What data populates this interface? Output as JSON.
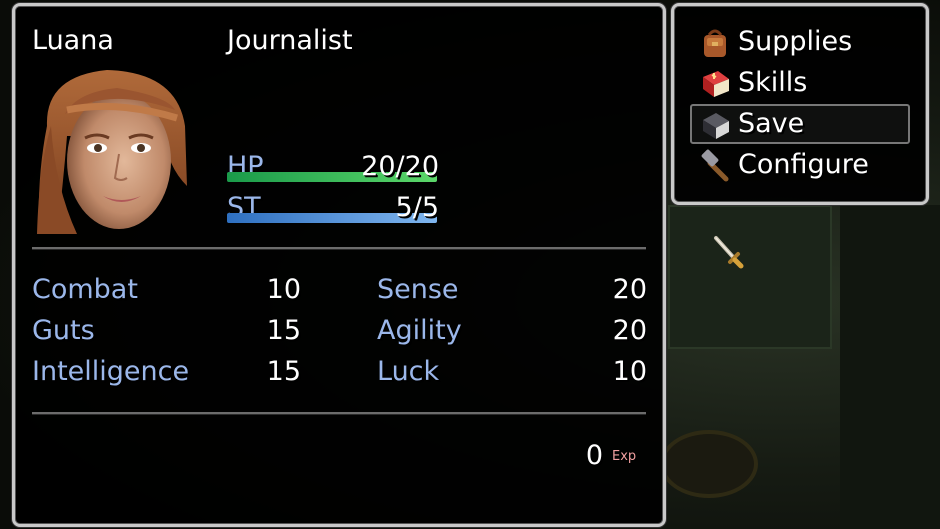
{
  "character": {
    "name": "Luana",
    "class": "Journalist",
    "hp": {
      "label": "HP",
      "value": "20/20",
      "fraction": 1.0
    },
    "st": {
      "label": "ST",
      "value": "5/5",
      "fraction": 1.0
    }
  },
  "stats": {
    "left": [
      {
        "label": "Combat",
        "value": "10"
      },
      {
        "label": "Guts",
        "value": "15"
      },
      {
        "label": "Intelligence",
        "value": "15"
      }
    ],
    "right": [
      {
        "label": "Sense",
        "value": "20"
      },
      {
        "label": "Agility",
        "value": "20"
      },
      {
        "label": "Luck",
        "value": "10"
      }
    ]
  },
  "exp": {
    "value": "0",
    "unit": "Exp"
  },
  "menu": {
    "items": [
      {
        "label": "Supplies",
        "icon": "backpack-icon"
      },
      {
        "label": "Skills",
        "icon": "red-book-icon"
      },
      {
        "label": "Save",
        "icon": "dark-book-icon",
        "selected": true
      },
      {
        "label": "Configure",
        "icon": "hammer-icon"
      }
    ]
  },
  "colors": {
    "stat_label": "#9bb7ea",
    "hp_bar": "#3cc35a",
    "st_bar": "#5a9ee0",
    "window_border": "#c9c9c9"
  }
}
